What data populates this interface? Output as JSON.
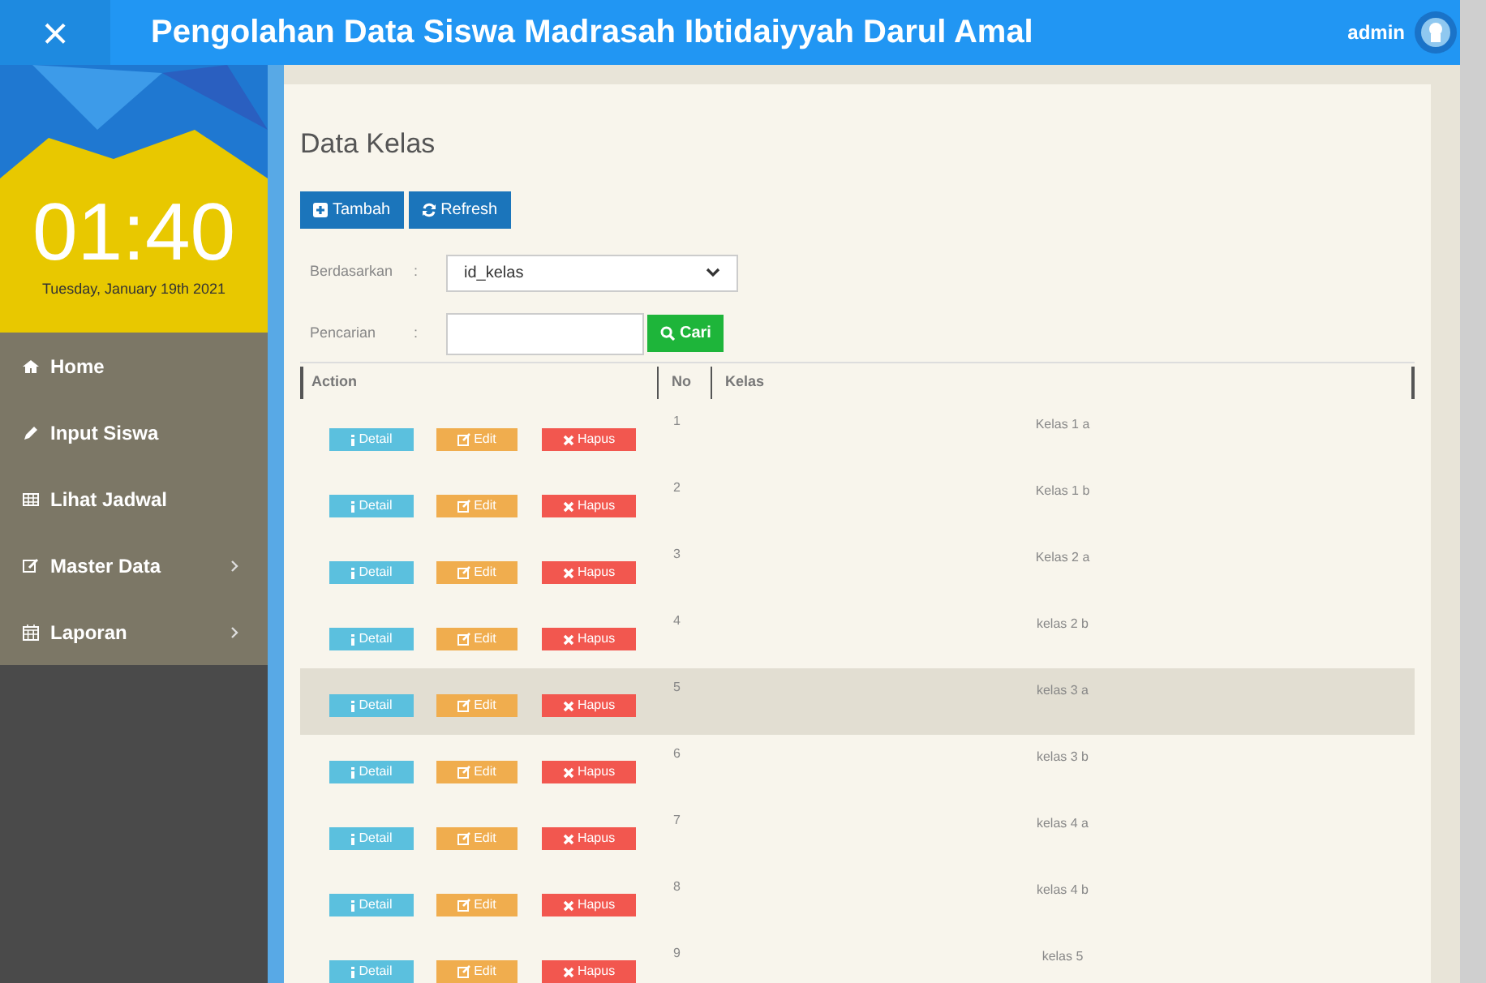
{
  "header": {
    "close_icon": "×",
    "title": "Pengolahan Data Siswa Madrasah Ibtidaiyyah Darul Amal",
    "user": "admin"
  },
  "sidebar": {
    "clock": "01:40",
    "date": "Tuesday, January 19th 2021",
    "items": [
      {
        "label": "Home",
        "has_submenu": false
      },
      {
        "label": "Input Siswa",
        "has_submenu": false
      },
      {
        "label": "Lihat Jadwal",
        "has_submenu": false
      },
      {
        "label": "Master Data",
        "has_submenu": true
      },
      {
        "label": "Laporan",
        "has_submenu": true
      }
    ]
  },
  "content": {
    "title": "Data Kelas",
    "buttons": [
      "Tambah",
      "Refresh"
    ],
    "filter": {
      "label": "Berdasarkan",
      "separator": ":",
      "value": "id_kelas"
    },
    "search": {
      "label": "Pencarian",
      "separator": ":",
      "button": "Cari"
    },
    "table": {
      "columns": [
        "Action",
        "No",
        "Kelas"
      ],
      "rows": [
        {
          "actions": [
            "Detail",
            "Edit",
            "Hapus"
          ],
          "no": "1",
          "kelas": "Kelas 1 a",
          "selected": false
        },
        {
          "actions": [
            "Detail",
            "Edit",
            "Hapus"
          ],
          "no": "2",
          "kelas": "Kelas 1 b",
          "selected": false
        },
        {
          "actions": [
            "Detail",
            "Edit",
            "Hapus"
          ],
          "no": "3",
          "kelas": "Kelas 2 a",
          "selected": false
        },
        {
          "actions": [
            "Detail",
            "Edit",
            "Hapus"
          ],
          "no": "4",
          "kelas": "kelas 2 b",
          "selected": false
        },
        {
          "actions": [
            "Detail",
            "Edit",
            "Hapus"
          ],
          "no": "5",
          "kelas": "kelas 3 a",
          "selected": true
        },
        {
          "actions": [
            "Detail",
            "Edit",
            "Hapus"
          ],
          "no": "6",
          "kelas": "kelas 3 b",
          "selected": false
        },
        {
          "actions": [
            "Detail",
            "Edit",
            "Hapus"
          ],
          "no": "7",
          "kelas": "kelas 4 a",
          "selected": false
        },
        {
          "actions": [
            "Detail",
            "Edit",
            "Hapus"
          ],
          "no": "8",
          "kelas": "kelas 4 b",
          "selected": false
        },
        {
          "actions": [
            "Detail",
            "Edit",
            "Hapus"
          ],
          "no": "9",
          "kelas": "kelas 5",
          "selected": false
        }
      ]
    }
  }
}
